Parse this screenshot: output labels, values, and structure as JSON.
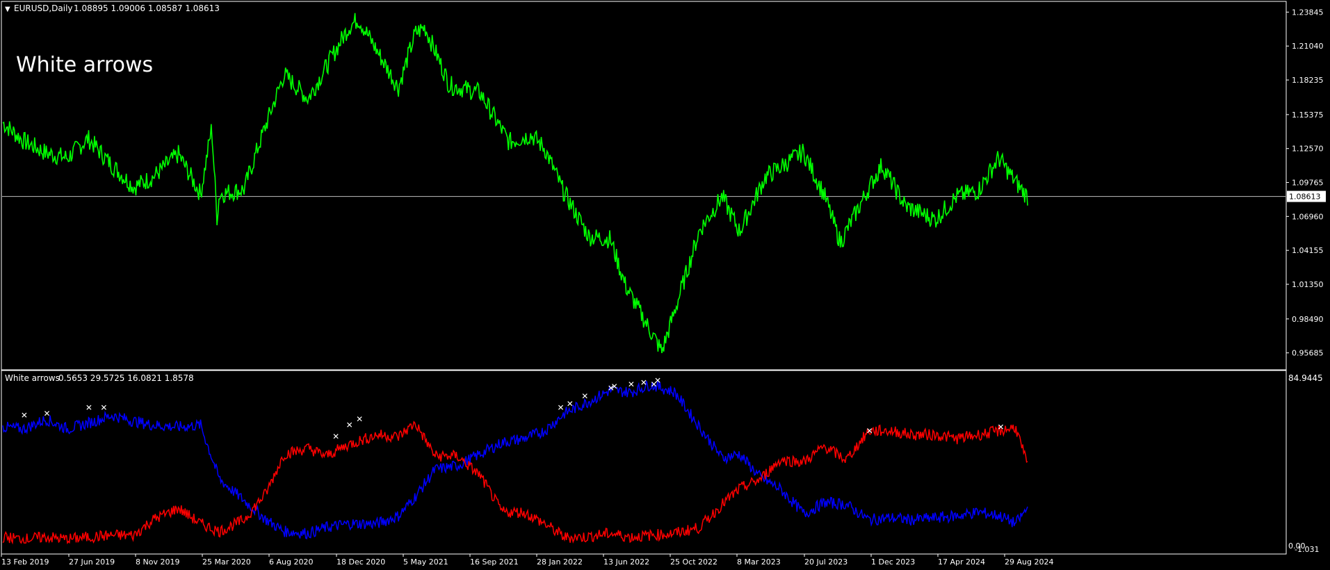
{
  "main_header": {
    "symbol": "EURUSD,Daily",
    "ohlc": "1.08895 1.09006 1.08587 1.08613"
  },
  "overlay_title": "White arrows",
  "price_axis": {
    "labels": [
      "1.23845",
      "1.21040",
      "1.18235",
      "1.15375",
      "1.12570",
      "1.09765",
      "1.06960",
      "1.04155",
      "1.01350",
      "0.98490",
      "0.95685"
    ],
    "current_price_label": "1.08613"
  },
  "sub_header": {
    "name": "White arrows",
    "values": "0.5653 29.5725 16.0821 1.8578"
  },
  "sub_axis": {
    "max_label": "84.9445",
    "zero_label": "0.00",
    "min_label": "-1.031"
  },
  "time_axis": {
    "labels": [
      "13 Feb 2019",
      "27 Jun 2019",
      "8 Nov 2019",
      "25 Mar 2020",
      "6 Aug 2020",
      "18 Dec 2020",
      "5 May 2021",
      "16 Sep 2021",
      "28 Jan 2022",
      "13 Jun 2022",
      "25 Oct 2022",
      "8 Mar 2023",
      "20 Jul 2023",
      "1 Dec 2023",
      "17 Apr 2024",
      "29 Aug 2024"
    ]
  },
  "colors": {
    "background": "#000000",
    "price_line": "#00ff00",
    "blue_line": "#0000ff",
    "red_line": "#ff0000",
    "marker": "#ffffff",
    "axis": "#ffffff",
    "current_price_line": "#c0c0c0"
  },
  "chart_data": [
    {
      "type": "line",
      "title": "EURUSD,Daily",
      "ylim": [
        0.944,
        1.245
      ],
      "series": [
        {
          "name": "EURUSD",
          "x": [
            "2019-01-01",
            "2019-02-13",
            "2019-04-01",
            "2019-05-15",
            "2019-06-27",
            "2019-08-15",
            "2019-09-30",
            "2019-11-08",
            "2019-12-31",
            "2020-02-15",
            "2020-03-09",
            "2020-03-20",
            "2020-03-25",
            "2020-05-15",
            "2020-06-15",
            "2020-08-06",
            "2020-09-25",
            "2020-12-18",
            "2021-01-07",
            "2021-03-31",
            "2021-05-05",
            "2021-05-25",
            "2021-07-15",
            "2021-09-16",
            "2021-11-15",
            "2021-12-31",
            "2022-01-28",
            "2022-03-07",
            "2022-04-30",
            "2022-06-13",
            "2022-07-15",
            "2022-09-28",
            "2022-10-25",
            "2022-12-15",
            "2023-01-31",
            "2023-03-08",
            "2023-04-30",
            "2023-07-18",
            "2023-08-31",
            "2023-10-03",
            "2023-12-01",
            "2023-12-28",
            "2024-02-15",
            "2024-04-17",
            "2024-05-31",
            "2024-07-15",
            "2024-08-26",
            "2024-09-30",
            "2024-10-25"
          ],
          "values": [
            1.147,
            1.132,
            1.122,
            1.118,
            1.134,
            1.112,
            1.094,
            1.102,
            1.121,
            1.088,
            1.143,
            1.069,
            1.088,
            1.092,
            1.129,
            1.187,
            1.167,
            1.226,
            1.233,
            1.176,
            1.221,
            1.226,
            1.178,
            1.172,
            1.131,
            1.137,
            1.126,
            1.091,
            1.053,
            1.051,
            1.012,
            0.958,
            0.992,
            1.058,
            1.086,
            1.057,
            1.102,
            1.123,
            1.087,
            1.048,
            1.093,
            1.112,
            1.078,
            1.067,
            1.086,
            1.091,
            1.118,
            1.098,
            1.086
          ]
        }
      ]
    },
    {
      "type": "line",
      "title": "White arrows",
      "ylim": [
        -1.031,
        84.9445
      ],
      "x": [
        "2019-01-01",
        "2019-02-13",
        "2019-04-01",
        "2019-05-15",
        "2019-06-27",
        "2019-08-15",
        "2019-09-30",
        "2019-11-08",
        "2019-12-31",
        "2020-02-15",
        "2020-03-25",
        "2020-05-15",
        "2020-06-30",
        "2020-08-06",
        "2020-09-25",
        "2020-11-01",
        "2020-12-18",
        "2021-02-15",
        "2021-03-31",
        "2021-05-05",
        "2021-06-15",
        "2021-07-31",
        "2021-09-16",
        "2021-11-01",
        "2021-12-15",
        "2022-01-28",
        "2022-03-10",
        "2022-04-20",
        "2022-06-13",
        "2022-07-25",
        "2022-09-05",
        "2022-10-25",
        "2022-12-15",
        "2023-01-31",
        "2023-03-08",
        "2023-04-20",
        "2023-05-31",
        "2023-07-20",
        "2023-08-31",
        "2023-10-15",
        "2023-12-01",
        "2024-01-15",
        "2024-02-28",
        "2024-04-17",
        "2024-05-31",
        "2024-07-15",
        "2024-08-29",
        "2024-09-30",
        "2024-10-25"
      ],
      "series": [
        {
          "name": "blue",
          "values": [
            60,
            59,
            64,
            59,
            62,
            66,
            63,
            61,
            60,
            61,
            33,
            22,
            12,
            6,
            5,
            8,
            10,
            10,
            14,
            24,
            38,
            40,
            46,
            52,
            54,
            58,
            67,
            72,
            79,
            78,
            82,
            78,
            60,
            44,
            46,
            34,
            28,
            15,
            21,
            20,
            12,
            13,
            12,
            13,
            14,
            16,
            14,
            10,
            18
          ]
        },
        {
          "name": "red",
          "values": [
            3,
            2,
            3,
            2,
            3,
            4,
            4,
            12,
            18,
            10,
            6,
            12,
            26,
            46,
            49,
            45,
            51,
            56,
            55,
            62,
            45,
            45,
            35,
            16,
            16,
            10,
            3,
            3,
            5,
            3,
            4,
            5,
            8,
            20,
            28,
            33,
            43,
            42,
            50,
            43,
            58,
            58,
            56,
            56,
            54,
            56,
            58,
            60,
            40
          ]
        }
      ],
      "markers": {
        "x": [
          "2019-02-13",
          "2019-04-01",
          "2019-06-27",
          "2019-07-28",
          "2020-11-20",
          "2020-12-18",
          "2021-01-08",
          "2022-03-01",
          "2022-03-20",
          "2022-04-20",
          "2022-06-13",
          "2022-06-20",
          "2022-07-25",
          "2022-08-20",
          "2022-09-10",
          "2022-09-18",
          "2023-12-01",
          "2024-08-29"
        ],
        "values": [
          66,
          67,
          70,
          70,
          55,
          61,
          64,
          70,
          72,
          76,
          80,
          81,
          82,
          83,
          82,
          84,
          58,
          60
        ]
      }
    }
  ]
}
